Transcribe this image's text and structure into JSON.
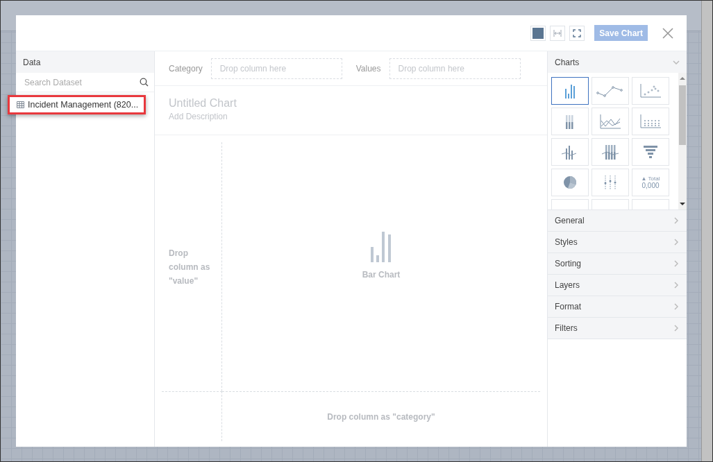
{
  "modal": {
    "save_button": {
      "label": "Save Chart",
      "disabled": true
    }
  },
  "data_panel": {
    "title": "Data",
    "search": {
      "placeholder": "Search Dataset"
    },
    "datasets": [
      {
        "label": "Incident Management (820...",
        "highlighted": true
      }
    ]
  },
  "builder": {
    "category": {
      "label": "Category",
      "placeholder": "Drop column here"
    },
    "values": {
      "label": "Values",
      "placeholder": "Drop column here"
    },
    "chart_title": {
      "placeholder": "Untitled Chart"
    },
    "description": {
      "placeholder": "Add Description"
    },
    "value_drop": "Drop column as \"value\"",
    "preview_label": "Bar Chart",
    "category_drop": "Drop column as \"category\""
  },
  "charts_panel": {
    "title": "Charts",
    "types": [
      {
        "kind": "bar",
        "selected": true
      },
      {
        "kind": "line",
        "selected": false
      },
      {
        "kind": "scatter",
        "selected": false
      },
      {
        "kind": "stacked",
        "selected": false
      },
      {
        "kind": "area",
        "selected": false
      },
      {
        "kind": "dots",
        "selected": false
      },
      {
        "kind": "combo",
        "selected": false
      },
      {
        "kind": "combo_stacked",
        "selected": false
      },
      {
        "kind": "funnel",
        "selected": false
      },
      {
        "kind": "pie",
        "selected": false
      },
      {
        "kind": "range",
        "selected": false
      },
      {
        "kind": "total",
        "selected": false,
        "marker": "▲",
        "label": "Total",
        "value": "0,000"
      },
      {
        "kind": "hidden",
        "selected": false
      },
      {
        "kind": "hidden",
        "selected": false
      },
      {
        "kind": "hidden",
        "selected": false
      }
    ]
  },
  "sections": [
    "General",
    "Styles",
    "Sorting",
    "Layers",
    "Format",
    "Filters"
  ]
}
